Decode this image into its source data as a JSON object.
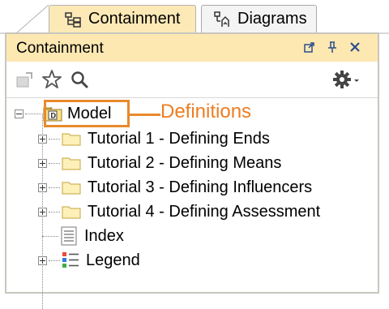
{
  "tabs": [
    {
      "label": "Containment",
      "icon": "containment-tree-icon",
      "active": true
    },
    {
      "label": "Diagrams",
      "icon": "diagrams-icon",
      "active": false
    }
  ],
  "panel": {
    "title": "Containment",
    "header_buttons": [
      "undock-icon",
      "pin-icon",
      "close-icon"
    ]
  },
  "toolbar": {
    "buttons": [
      "new-element-icon",
      "favorites-star-icon",
      "search-icon",
      "settings-gear-icon"
    ]
  },
  "tree": {
    "root": {
      "label": "Model",
      "icon": "package-icon",
      "expanded": true
    },
    "children": [
      {
        "label": "Tutorial 1 - Defining Ends",
        "icon": "folder-icon",
        "expandable": true
      },
      {
        "label": "Tutorial 2 - Defining Means",
        "icon": "folder-icon",
        "expandable": true
      },
      {
        "label": "Tutorial 3 - Defining Influencers",
        "icon": "folder-icon",
        "expandable": true
      },
      {
        "label": "Tutorial 4 - Defining Assessment",
        "icon": "folder-icon",
        "expandable": true
      },
      {
        "label": "Index",
        "icon": "document-icon",
        "expandable": false
      },
      {
        "label": "Legend",
        "icon": "legend-icon",
        "expandable": true
      }
    ]
  },
  "callout": {
    "text": "Definitions",
    "color": "#ed7d22"
  },
  "colors": {
    "tab_active": "#fde9b6",
    "panel_header": "#fde8b2",
    "accent": "#ed7d22"
  }
}
